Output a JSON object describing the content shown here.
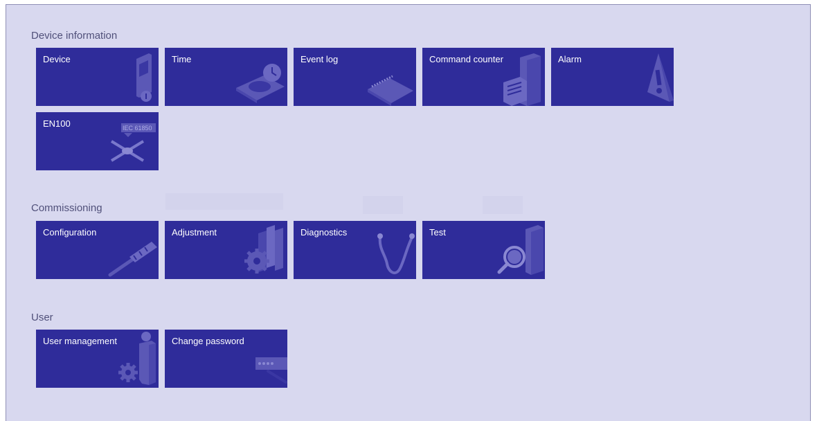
{
  "sections": {
    "device_information": {
      "title": "Device information",
      "tiles": [
        {
          "label": "Device",
          "icon": "device-info-icon"
        },
        {
          "label": "Time",
          "icon": "clock-icon"
        },
        {
          "label": "Event log",
          "icon": "notebook-icon"
        },
        {
          "label": "Command counter",
          "icon": "file-cabinet-icon"
        },
        {
          "label": "Alarm",
          "icon": "warning-icon"
        },
        {
          "label": "EN100",
          "icon": "iec61850-network-icon",
          "badge": "IEC 61850"
        }
      ]
    },
    "commissioning": {
      "title": "Commissioning",
      "tiles": [
        {
          "label": "Configuration",
          "icon": "screwdriver-icon"
        },
        {
          "label": "Adjustment",
          "icon": "gear-binders-icon"
        },
        {
          "label": "Diagnostics",
          "icon": "stethoscope-icon"
        },
        {
          "label": "Test",
          "icon": "magnifier-device-icon"
        }
      ]
    },
    "user": {
      "title": "User",
      "tiles": [
        {
          "label": "User management",
          "icon": "user-gear-icon"
        },
        {
          "label": "Change password",
          "icon": "password-field-icon"
        }
      ]
    }
  },
  "colors": {
    "background": "#d8d8ef",
    "tile": "#2f2c9a",
    "icon": "#5b58b6",
    "section_title": "#50507a"
  }
}
